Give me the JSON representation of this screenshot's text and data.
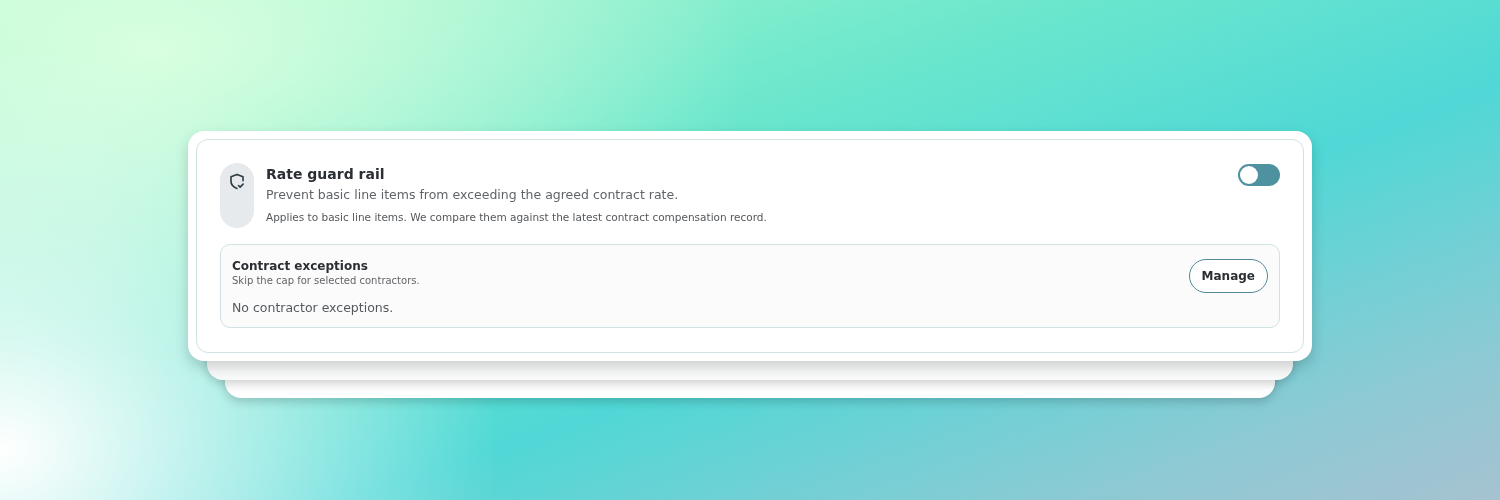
{
  "setting": {
    "title": "Rate guard rail",
    "description": "Prevent basic line items from exceeding the agreed contract rate.",
    "note": "Applies to basic line items. We compare them against the latest contract compensation record.",
    "on": false
  },
  "exceptions": {
    "title": "Contract exceptions",
    "subtitle": "Skip the cap for selected contractors.",
    "button": "Manage",
    "empty_text": "No contractor exceptions."
  }
}
